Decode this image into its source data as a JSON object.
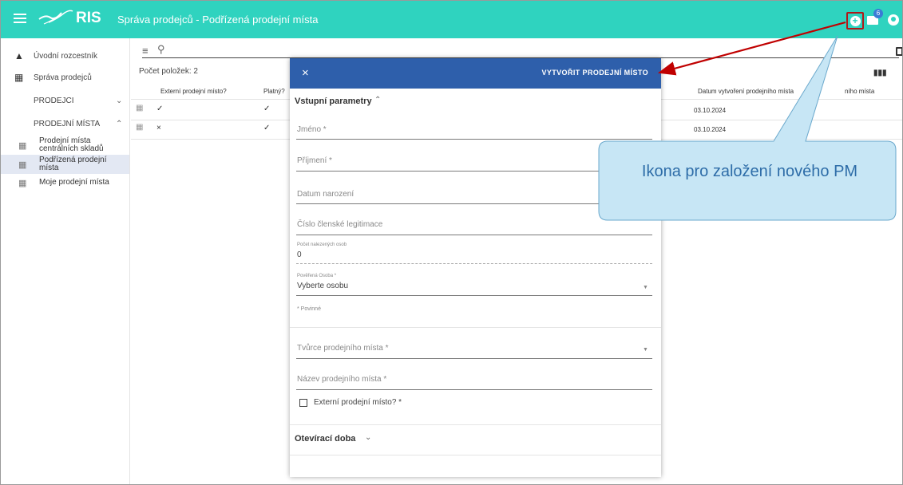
{
  "header": {
    "logo_text": "RIS",
    "title": "Správa prodejců - Podřízená prodejní místa",
    "mail_badge": "6",
    "brand_color": "#2fd3bf"
  },
  "sidebar": {
    "items": [
      {
        "label": "Úvodní rozcestník",
        "icon": "home-icon"
      },
      {
        "label": "Správa prodejců",
        "icon": "dashboard-icon"
      }
    ],
    "section_sellers": "PRODEJCI",
    "section_places": "PRODEJNÍ MÍSTA",
    "sub_items": [
      {
        "label": "Prodejní místa centrálních skladů"
      },
      {
        "label": "Podřízená prodejní místa",
        "active": true
      },
      {
        "label": "Moje prodejní místa"
      }
    ]
  },
  "main": {
    "count_text": "Počet položek: 2",
    "columns": {
      "external": "Externí prodejní místo?",
      "valid": "Platný?",
      "created": "Datum vytvoření prodejního místa",
      "last": "ního místa"
    },
    "rows": [
      {
        "external": "✓",
        "valid": "✓",
        "created": "03.10.2024"
      },
      {
        "external": "×",
        "valid": "✓",
        "created": "03.10.2024"
      }
    ]
  },
  "dialog": {
    "close": "×",
    "create_label": "VYTVOŘIT PRODEJNÍ MÍSTO",
    "header_color": "#2e5fab",
    "section_params": "Vstupní parametry",
    "first_name": "Jméno *",
    "last_name": "Příjmení *",
    "birth_date": "Datum narození",
    "membership": "Číslo členské legitimace",
    "found_label": "Počet nalezených osob",
    "found_value": "0",
    "person_label": "Pověřená Osoba *",
    "person_placeholder": "Vyberte osobu",
    "required_note": "* Povinné",
    "creator": "Tvůrce prodejního místa *",
    "place_name": "Název prodejního místa *",
    "external_checkbox": "Externí prodejní místo? *",
    "section_hours": "Otevírací doba"
  },
  "callout": {
    "text": "Ikona pro založení nového PM"
  }
}
